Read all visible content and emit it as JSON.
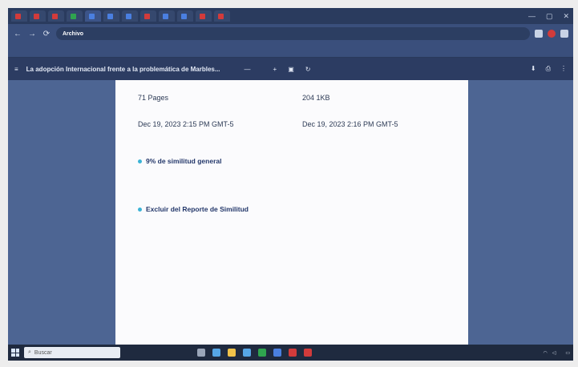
{
  "browser": {
    "tabs": [
      {
        "label": "",
        "color": "#d23b3b"
      },
      {
        "label": "",
        "color": "#d23b3b"
      },
      {
        "label": "",
        "color": "#d23b3b"
      },
      {
        "label": "",
        "color": "#2fa44f"
      },
      {
        "label": "",
        "color": "#4a7fe0",
        "active": true
      },
      {
        "label": "",
        "color": "#4a7fe0"
      },
      {
        "label": "",
        "color": "#4a7fe0"
      },
      {
        "label": "",
        "color": "#d23b3b"
      },
      {
        "label": "",
        "color": "#4a7fe0"
      },
      {
        "label": "",
        "color": "#4a7fe0"
      },
      {
        "label": "",
        "color": "#d23b3b"
      },
      {
        "label": "",
        "color": "#d23b3b"
      }
    ],
    "window_controls": {
      "minimize": "—",
      "maximize": "▢",
      "close": "✕"
    },
    "address": {
      "badge": "Archivo",
      "url": ""
    },
    "nav": {
      "back": "←",
      "forward": "→",
      "reload": "⟳"
    },
    "bookmarks": {
      "items": [
        "",
        "",
        ""
      ],
      "right": ""
    }
  },
  "pdf_viewer": {
    "title": "La adopción Internacional frente a la problemática de Marbles...",
    "page_controls": {
      "minus": "—",
      "zoom": "",
      "plus": "+"
    },
    "right_icons": [
      "download-icon",
      "print-icon"
    ]
  },
  "document": {
    "meta": [
      {
        "label": "",
        "value": "71 Pages"
      },
      {
        "label": "",
        "value": "204 1KB"
      },
      {
        "label": "",
        "value": "Dec 19, 2023 2:15 PM GMT-5"
      },
      {
        "label": "",
        "value": "Dec 19, 2023 2:16 PM GMT-5"
      }
    ],
    "similarity_section": {
      "title": "9% de similitud general",
      "description": "",
      "items": [
        "",
        "",
        "",
        "",
        ""
      ]
    },
    "excluded_section": {
      "title": "Excluir del Reporte de Similitud",
      "items": [
        "",
        "",
        "",
        ""
      ]
    }
  },
  "taskbar": {
    "search_placeholder": "Buscar",
    "app_colors": [
      "#9aa5b8",
      "#56a6e6",
      "#f0c24a",
      "#56a6e6",
      "#2fa44f",
      "#4a7fe0",
      "#d23b3b",
      "#d23b3b"
    ],
    "tray_text": ""
  }
}
